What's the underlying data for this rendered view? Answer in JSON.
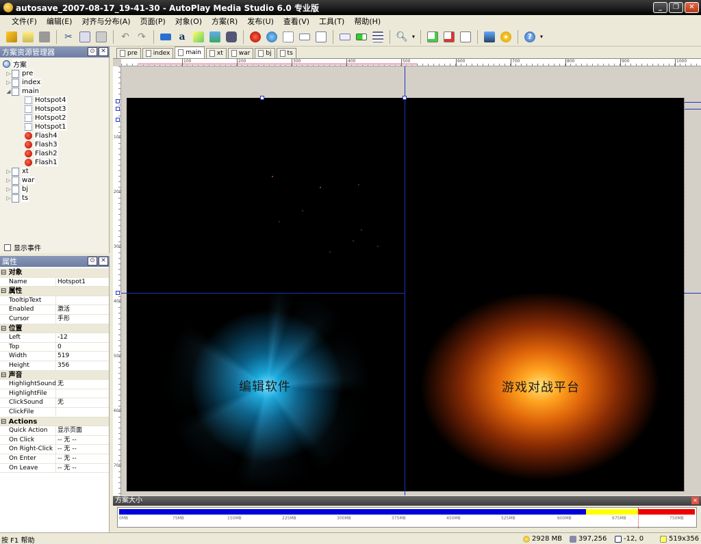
{
  "window": {
    "title": "autosave_2007-08-17_19-41-30 - AutoPlay Media Studio 6.0 专业版",
    "min_label": "_",
    "max_label": "❐",
    "close_label": "✕"
  },
  "menu": [
    "文件(F)",
    "编辑(E)",
    "对齐与分布(A)",
    "页面(P)",
    "对象(O)",
    "方案(R)",
    "发布(U)",
    "查看(V)",
    "工具(T)",
    "帮助(H)"
  ],
  "toolbar": {
    "icons": [
      "wizard-icon",
      "open-icon",
      "save-icon",
      "cut-icon",
      "copy-icon",
      "paste-icon",
      "undo-icon",
      "redo-icon",
      "button-object-icon",
      "label-object-icon",
      "paragraph-object-icon",
      "image-object-icon",
      "video-object-icon",
      "flash-object-icon",
      "web-object-icon",
      "hotspot-object-icon",
      "input-object-icon",
      "listbox-object-icon",
      "combobox-object-icon",
      "progress-object-icon",
      "tree-object-icon",
      "zoom-icon",
      "new-page-icon",
      "delete-page-icon",
      "page-properties-icon",
      "preview-icon",
      "build-icon",
      "help-icon"
    ]
  },
  "explorer": {
    "title": "方案资源管理器",
    "root": "方案",
    "items": [
      "pre",
      "index",
      "main",
      "Hotspot4",
      "Hotspot3",
      "Hotspot2",
      "Hotspot1",
      "Flash4",
      "Flash3",
      "Flash2",
      "Flash1",
      "xt",
      "war",
      "bj",
      "ts"
    ],
    "show_events": "显示事件"
  },
  "properties": {
    "title": "属性",
    "rows": [
      {
        "cat": "对象"
      },
      {
        "name": "Name",
        "value": "Hotspot1"
      },
      {
        "cat": "属性"
      },
      {
        "name": "TooltipText",
        "value": ""
      },
      {
        "name": "Enabled",
        "value": "激活"
      },
      {
        "name": "Cursor",
        "value": "手形"
      },
      {
        "cat": "位置"
      },
      {
        "name": "Left",
        "value": "-12"
      },
      {
        "name": "Top",
        "value": "0"
      },
      {
        "name": "Width",
        "value": "519"
      },
      {
        "name": "Height",
        "value": "356"
      },
      {
        "cat": "声音"
      },
      {
        "name": "HighlightSound",
        "value": "无"
      },
      {
        "name": "HighlightFile",
        "value": ""
      },
      {
        "name": "ClickSound",
        "value": "无"
      },
      {
        "name": "ClickFile",
        "value": ""
      },
      {
        "cat": "Actions"
      },
      {
        "name": "Quick Action",
        "value": "显示页面"
      },
      {
        "name": "On Click",
        "value": "-- 无 --"
      },
      {
        "name": "On Right-Click",
        "value": "-- 无 --"
      },
      {
        "name": "On Enter",
        "value": "-- 无 --"
      },
      {
        "name": "On Leave",
        "value": "-- 无 --"
      }
    ]
  },
  "tabs": [
    "pre",
    "index",
    "main",
    "xt",
    "war",
    "bj",
    "ts"
  ],
  "active_tab": "main",
  "ruler": {
    "h": [
      "100",
      "200",
      "300",
      "400",
      "500",
      "600",
      "700",
      "800",
      "900",
      "1000"
    ],
    "v": [
      "100",
      "200",
      "300",
      "400",
      "500",
      "600",
      "700"
    ]
  },
  "canvas": {
    "left_label": "编辑软件",
    "right_label": "游戏对战平台"
  },
  "project_size": {
    "title": "方案大小",
    "ticks": [
      "0MB",
      "75MB",
      "150MB",
      "225MB",
      "300MB",
      "375MB",
      "450MB",
      "525MB",
      "600MB",
      "675MB",
      "750MB"
    ]
  },
  "status": {
    "help": "按 F1 帮助",
    "disk": "2928 MB",
    "coords": "397,256",
    "position": "-12, 0",
    "size": "519x356"
  },
  "colors": {
    "size_blue": "#0000dd",
    "size_yellow": "#ffff00",
    "size_red": "#ee0000"
  }
}
